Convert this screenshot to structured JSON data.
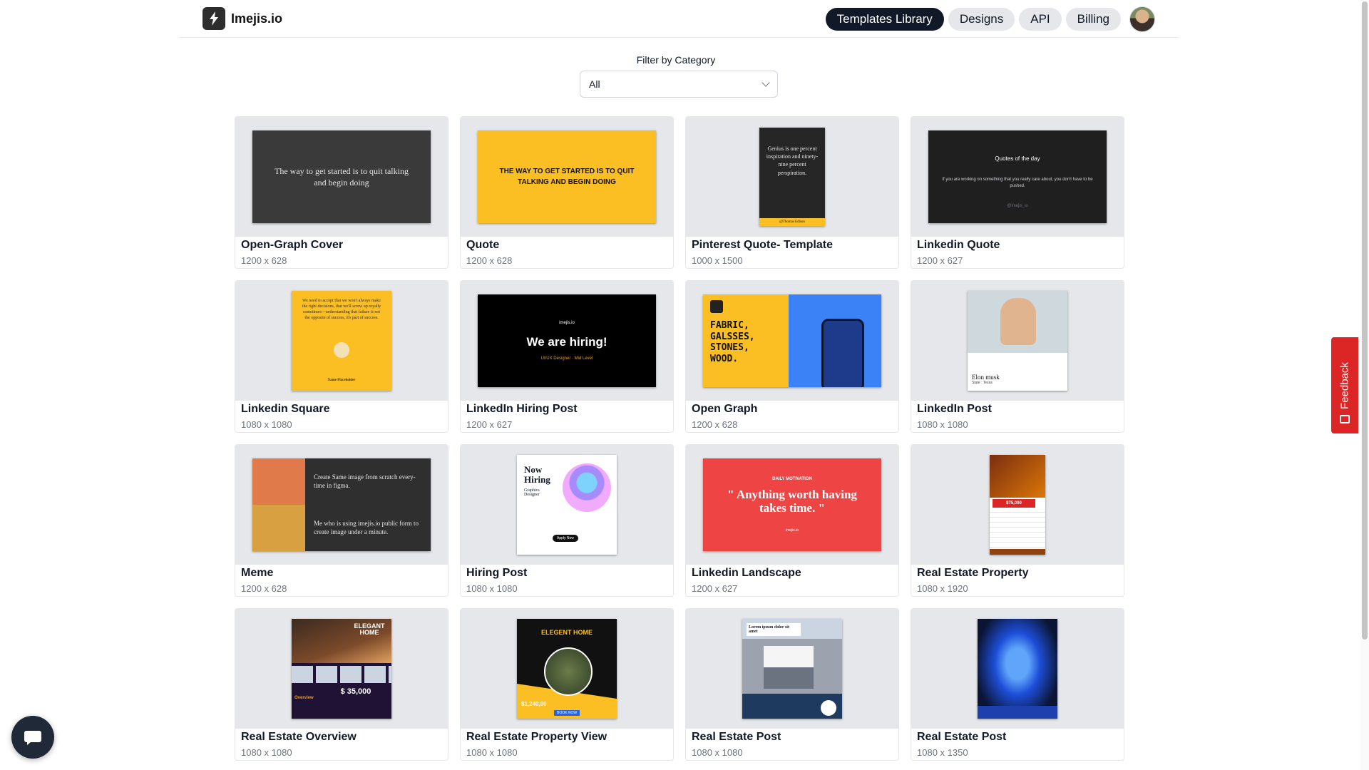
{
  "header": {
    "brand": "Imejis.io",
    "nav": [
      {
        "label": "Templates Library",
        "active": true
      },
      {
        "label": "Designs",
        "active": false
      },
      {
        "label": "API",
        "active": false
      },
      {
        "label": "Billing",
        "active": false
      }
    ]
  },
  "filter": {
    "label": "Filter by Category",
    "value": "All"
  },
  "templates": [
    {
      "name": "Open-Graph Cover",
      "size": "1200 x 628",
      "preview_text": "The way to get started is to quit talking and begin doing"
    },
    {
      "name": "Quote",
      "size": "1200 x 628",
      "preview_text": "THE WAY TO GET STARTED IS TO QUIT TALKING AND BEGIN DOING"
    },
    {
      "name": "Pinterest Quote- Template",
      "size": "1000 x 1500",
      "preview_text": "Genius is one percent inspiration and ninety-nine percent perspiration.",
      "preview_author": "@Thomas Edison"
    },
    {
      "name": "Linkedin Quote",
      "size": "1200 x 627",
      "preview_title": "Quotes of the day",
      "preview_text": "If you are working on something that you really care about, you don't have to be pushed.",
      "preview_handle": "@imejis_io"
    },
    {
      "name": "Linkedin Square",
      "size": "1080 x 1080",
      "preview_text": "We need to accept that we won't always make the right decisions, that we'll screw up royally sometimes—understanding that failure is not the opposite of success, it's part of success.",
      "preview_author": "Name Placeholder"
    },
    {
      "name": "LinkedIn Hiring Post",
      "size": "1200 x 627",
      "preview_brand": "imejis.io",
      "preview_title": "We are hiring!",
      "preview_text": "UI/UX Designer · Mid Level"
    },
    {
      "name": "Open Graph",
      "size": "1200 x 628",
      "preview_text": "FABRIC, GALSSES, STONES, WOOD."
    },
    {
      "name": "LinkedIn Post",
      "size": "1080 x 1080",
      "preview_title": "Elon musk",
      "preview_text": "State : Texas"
    },
    {
      "name": "Meme",
      "size": "1200 x 628",
      "preview_text": "Create Same image from scratch every-time in figma.",
      "preview_text2": "Me who is using imejis.io public form to create image under a minute."
    },
    {
      "name": "Hiring Post",
      "size": "1080 x 1080",
      "preview_title": "Now Hiring",
      "preview_text": "Graphics Designer",
      "preview_button": "Apply Now"
    },
    {
      "name": "Linkedin Landscape",
      "size": "1200 x 627",
      "preview_title": "DAILY MOTIVATION",
      "preview_text": "\" Anything worth having takes time. \"",
      "preview_brand": "imejis.io"
    },
    {
      "name": "Real Estate Property",
      "size": "1080 x 1920",
      "preview_text": "$75,000"
    },
    {
      "name": "Real Estate Overview",
      "size": "1080 x 1080",
      "preview_title": "ELEGANT HOME",
      "preview_text": "$ 35,000",
      "preview_label": "Overview"
    },
    {
      "name": "Real Estate Property View",
      "size": "1080 x 1080",
      "preview_title": "ELEGENT HOME",
      "preview_text": "$1,240,00",
      "preview_button": "BOOK NOW"
    },
    {
      "name": "Real Estate Post",
      "size": "1080 x 1080",
      "preview_text": "Lorem ipsum dolor sit amet"
    },
    {
      "name": "Real Estate Post",
      "size": "1080 x 1350",
      "preview_text": ""
    }
  ],
  "widgets": {
    "feedback": "Feedback"
  },
  "colors": {
    "accent": "#111827",
    "feedback": "#dc2626",
    "quote_yellow": "#fbbf24",
    "landscape_red": "#ef4444"
  }
}
